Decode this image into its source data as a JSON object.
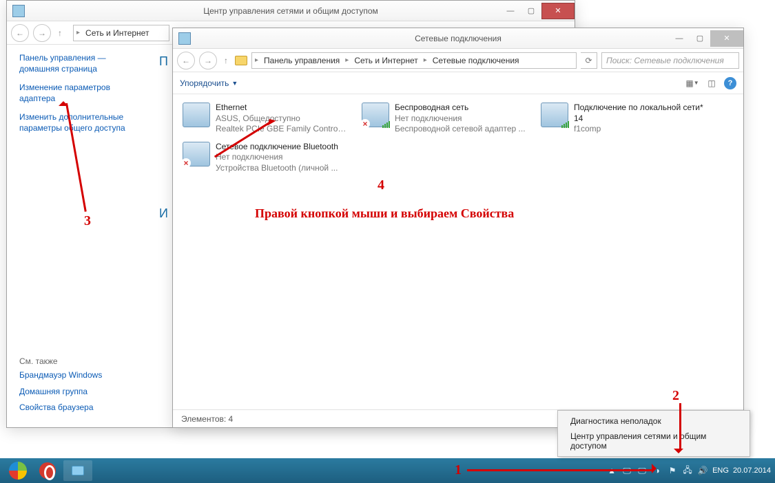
{
  "back_window": {
    "title": "Центр управления сетями и общим доступом",
    "breadcrumb_fragment": "Сеть и Интернет",
    "sidebar": {
      "home": "Панель управления — домашняя страница",
      "adapter": "Изменение параметров адаптера",
      "sharing": "Изменить дополнительные параметры общего доступа",
      "see_also": "См. также",
      "firewall": "Брандмауэр Windows",
      "homegroup": "Домашняя группа",
      "browser": "Свойства браузера"
    },
    "main_heading_stub": "П"
  },
  "front_window": {
    "title": "Сетевые подключения",
    "breadcrumb": [
      "Панель управления",
      "Сеть и Интернет",
      "Сетевые подключения"
    ],
    "search_placeholder": "Поиск: Сетевые подключения",
    "organize": "Упорядочить",
    "connections": [
      {
        "name": "Ethernet",
        "status": "ASUS, Общедоступно",
        "device": "Realtek PCIe GBE Family Controller",
        "x": false,
        "bars": false
      },
      {
        "name": "Беспроводная сеть",
        "status": "Нет подключения",
        "device": "Беспроводной сетевой адаптер ...",
        "x": true,
        "bars": true
      },
      {
        "name": "Подключение по локальной сети* 14",
        "status": "",
        "device": "f1comp",
        "x": false,
        "bars": true
      },
      {
        "name": "Сетевое подключение Bluetooth",
        "status": "Нет подключения",
        "device": "Устройства Bluetooth (личной ...",
        "x": true,
        "bars": false
      }
    ],
    "status_bar": "Элементов: 4"
  },
  "context_menu": {
    "item1": "Диагностика неполадок",
    "item2": "Центр управления сетями и общим доступом"
  },
  "taskbar": {
    "lang": "ENG",
    "date": "20.07.2014"
  },
  "annotations": {
    "n1": "1",
    "n2": "2",
    "n3": "3",
    "n4": "4",
    "hint": "Правой кнопкой мыши и выбираем Свойства"
  }
}
